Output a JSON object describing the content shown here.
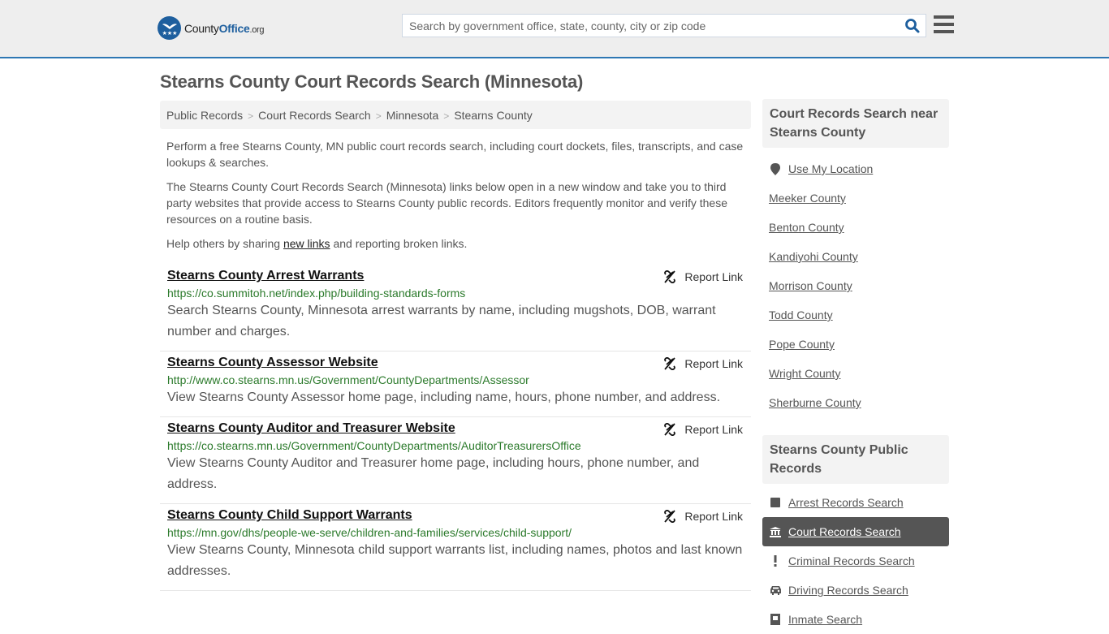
{
  "header": {
    "logo": {
      "name_plain": "County",
      "name_brand": "Office",
      "tld": ".org"
    },
    "search": {
      "placeholder": "Search by government office, state, county, city or zip code",
      "value": ""
    },
    "search_icon": "magnifier-icon",
    "menu_icon": "hamburger-icon"
  },
  "page": {
    "title": "Stearns County Court Records Search (Minnesota)",
    "breadcrumb": [
      "Public Records",
      "Court Records Search",
      "Minnesota",
      "Stearns County"
    ],
    "intro": {
      "p1": "Perform a free Stearns County, MN public court records search, including court dockets, files, transcripts, and case lookups & searches.",
      "p2": "The Stearns County Court Records Search (Minnesota) links below open in a new window and take you to third party websites that provide access to Stearns County public records. Editors frequently monitor and verify these resources on a routine basis.",
      "p3_before": "Help others by sharing ",
      "p3_link": "new links",
      "p3_after": " and reporting broken links."
    },
    "report_label": "Report Link",
    "results": [
      {
        "title": "Stearns County Arrest Warrants",
        "url": "https://co.summitoh.net/index.php/building-standards-forms",
        "description": "Search Stearns County, Minnesota arrest warrants by name, including mugshots, DOB, warrant number and charges."
      },
      {
        "title": "Stearns County Assessor Website",
        "url": "http://www.co.stearns.mn.us/Government/CountyDepartments/Assessor",
        "description": "View Stearns County Assessor home page, including name, hours, phone number, and address."
      },
      {
        "title": "Stearns County Auditor and Treasurer Website",
        "url": "https://co.stearns.mn.us/Government/CountyDepartments/AuditorTreasurersOffice",
        "description": "View Stearns County Auditor and Treasurer home page, including hours, phone number, and address."
      },
      {
        "title": "Stearns County Child Support Warrants",
        "url": "https://mn.gov/dhs/people-we-serve/children-and-families/services/child-support/",
        "description": "View Stearns County, Minnesota child support warrants list, including names, photos and last known addresses."
      }
    ]
  },
  "sidebar": {
    "nearby": {
      "heading": "Court Records Search near Stearns County",
      "use_location": "Use My Location",
      "counties": [
        "Meeker County",
        "Benton County",
        "Kandiyohi County",
        "Morrison County",
        "Todd County",
        "Pope County",
        "Wright County",
        "Sherburne County"
      ]
    },
    "public_records": {
      "heading": "Stearns County Public Records",
      "items": [
        {
          "label": "Arrest Records Search",
          "icon": "square-icon",
          "active": false
        },
        {
          "label": "Court Records Search",
          "icon": "courthouse-icon",
          "active": true
        },
        {
          "label": "Criminal Records Search",
          "icon": "exclamation-icon",
          "active": false
        },
        {
          "label": "Driving Records Search",
          "icon": "car-icon",
          "active": false
        },
        {
          "label": "Inmate Search",
          "icon": "jail-icon",
          "active": false
        }
      ]
    }
  },
  "colors": {
    "brand_blue": "#1e5f9e",
    "header_border": "#2e77b3",
    "url_green": "#2b7a2b",
    "active_bg": "#555555"
  }
}
